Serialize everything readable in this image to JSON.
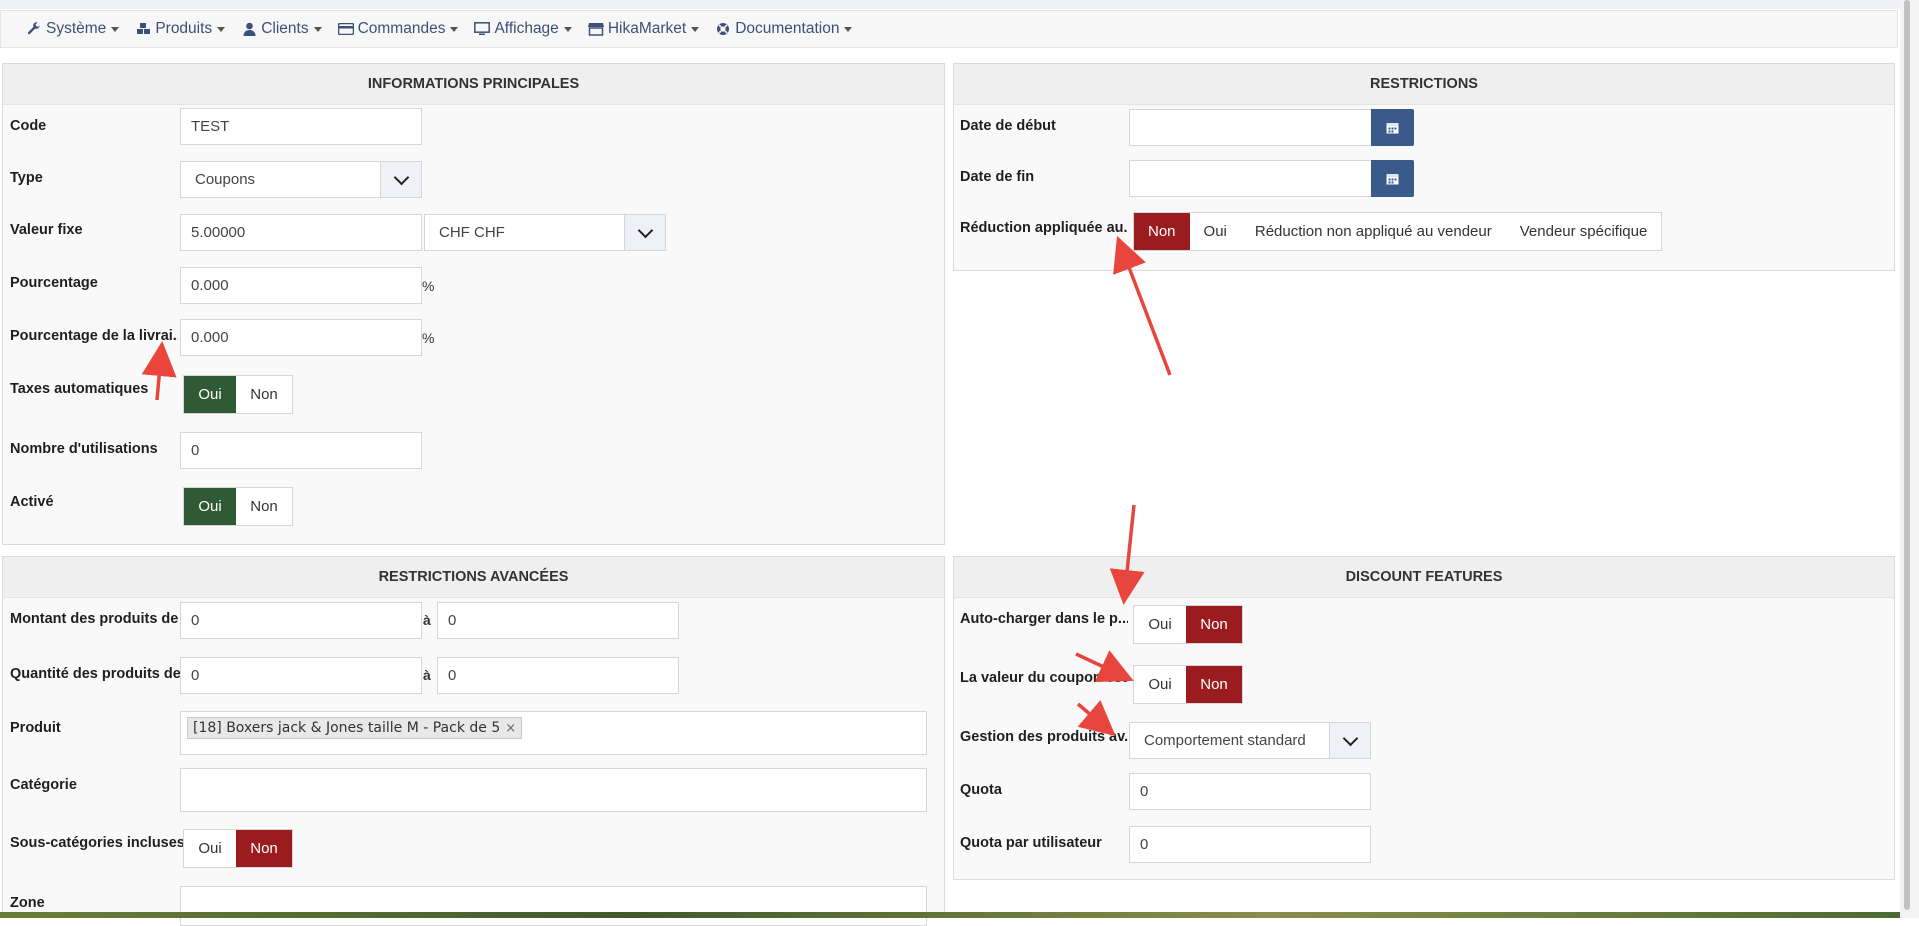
{
  "menu": [
    {
      "label": "Système",
      "icon": "wrench-icon"
    },
    {
      "label": "Produits",
      "icon": "cubes-icon"
    },
    {
      "label": "Clients",
      "icon": "user-icon"
    },
    {
      "label": "Commandes",
      "icon": "credit-card-icon"
    },
    {
      "label": "Affichage",
      "icon": "monitor-icon"
    },
    {
      "label": "HikaMarket",
      "icon": "store-icon"
    },
    {
      "label": "Documentation",
      "icon": "lifebuoy-icon"
    }
  ],
  "info": {
    "title": "INFORMATIONS PRINCIPALES",
    "code": {
      "label": "Code",
      "value": "TEST"
    },
    "type": {
      "label": "Type",
      "value": "Coupons"
    },
    "fixed": {
      "label": "Valeur fixe",
      "value": "5.00000",
      "currency": "CHF CHF"
    },
    "percent": {
      "label": "Pourcentage",
      "value": "0.000",
      "unit": "%"
    },
    "shipping_percent": {
      "label": "Pourcentage de la livrai...",
      "value": "0.000",
      "unit": "%"
    },
    "auto_tax": {
      "label": "Taxes automatiques",
      "yes": "Oui",
      "no": "Non"
    },
    "uses": {
      "label": "Nombre d'utilisations",
      "value": "0"
    },
    "active": {
      "label": "Activé",
      "yes": "Oui",
      "no": "Non"
    }
  },
  "restrictions": {
    "title": "RESTRICTIONS",
    "start": {
      "label": "Date de début",
      "value": ""
    },
    "end": {
      "label": "Date de fin",
      "value": ""
    },
    "applied": {
      "label": "Réduction appliquée au...",
      "options": [
        "Non",
        "Oui",
        "Réduction non appliqué au vendeur",
        "Vendeur spécifique"
      ],
      "selected": "Non"
    }
  },
  "advanced": {
    "title": "RESTRICTIONS AVANCÉES",
    "amount": {
      "label": "Montant des produits de",
      "from": "0",
      "sep": "à",
      "to": "0"
    },
    "qty": {
      "label": "Quantité des produits de",
      "from": "0",
      "sep": "à",
      "to": "0"
    },
    "product": {
      "label": "Produit",
      "tag": "[18] Boxers jack & Jones taille M - Pack de 5",
      "remove": "×"
    },
    "category": {
      "label": "Catégorie"
    },
    "subcats": {
      "label": "Sous-catégories incluses",
      "yes": "Oui",
      "no": "Non"
    },
    "zone": {
      "label": "Zone"
    }
  },
  "features": {
    "title": "DISCOUNT FEATURES",
    "autoload": {
      "label": "Auto-charger dans le p...",
      "yes": "Oui",
      "no": "Non"
    },
    "coupon_value": {
      "label": "La valeur du coupon est...",
      "yes": "Oui",
      "no": "Non"
    },
    "products_mgmt": {
      "label": "Gestion des produits av...",
      "value": "Comportement standard"
    },
    "quota": {
      "label": "Quota",
      "value": "0"
    },
    "quota_user": {
      "label": "Quota par utilisateur",
      "value": "0"
    }
  },
  "colors": {
    "accent_red": "#9b1c1f",
    "accent_green": "#2f5a34",
    "cal_blue": "#3a5a8c",
    "arrow": "#e8453c",
    "menu_text": "#3c5079"
  }
}
